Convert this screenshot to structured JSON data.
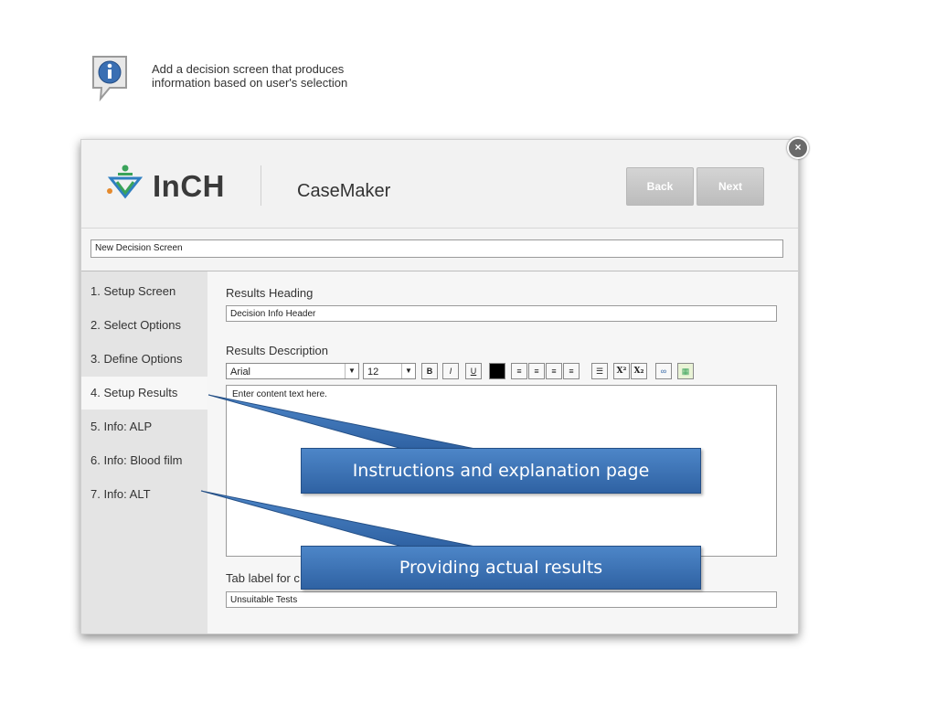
{
  "info": {
    "line1": "Add a decision screen that produces",
    "line2": "information based on user's selection"
  },
  "header": {
    "logo_text": "InCH",
    "app_title": "CaseMaker",
    "back_label": "Back",
    "next_label": "Next",
    "close_symbol": "×"
  },
  "screen_name": "New Decision Screen",
  "sidebar": {
    "items": [
      {
        "label": "1. Setup Screen"
      },
      {
        "label": "2. Select Options"
      },
      {
        "label": "3. Define Options"
      },
      {
        "label": "4. Setup Results"
      },
      {
        "label": "5. Info: ALP"
      },
      {
        "label": "6. Info: Blood film"
      },
      {
        "label": "7. Info: ALT"
      }
    ],
    "active_index": 3
  },
  "content": {
    "results_heading_label": "Results Heading",
    "results_heading_value": "Decision Info Header",
    "results_description_label": "Results Description",
    "toolbar": {
      "font": "Arial",
      "size": "12",
      "bold": "B",
      "italic": "I",
      "underline": "U",
      "superscript": "X²",
      "subscript": "X₂"
    },
    "editor_text": "Enter content text here.",
    "tab_label": "Tab label for c",
    "tab_value": "Unsuitable Tests"
  },
  "callouts": {
    "first": "Instructions and explanation page",
    "second": "Providing actual results"
  },
  "colors": {
    "callout_blue": "#3a6fb3",
    "logo_green": "#3aa35a",
    "logo_blue": "#2f7fc1",
    "logo_orange": "#e58a2d"
  }
}
